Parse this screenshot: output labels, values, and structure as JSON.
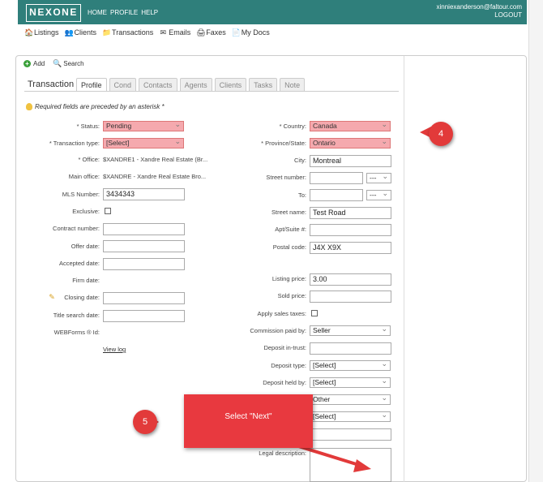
{
  "header": {
    "logo": "NEXONE",
    "nav": [
      "HOME",
      "PROFILE",
      "HELP"
    ],
    "user_email": "xinniexanderson@faltour.com",
    "logout": "LOGOUT"
  },
  "modules": [
    {
      "label": "Listings",
      "icon": "house-icon"
    },
    {
      "label": "Clients",
      "icon": "people-icon"
    },
    {
      "label": "Transactions",
      "icon": "folder-icon"
    },
    {
      "label": "Emails",
      "icon": "envelope-icon"
    },
    {
      "label": "Faxes",
      "icon": "printer-icon"
    },
    {
      "label": "My Docs",
      "icon": "documents-icon"
    }
  ],
  "actions": {
    "add": "Add",
    "search": "Search"
  },
  "page_title": "Transaction",
  "tabs": [
    "Profile",
    "Cond",
    "Contacts",
    "Agents",
    "Clients",
    "Tasks",
    "Note"
  ],
  "required_note": "Required fields are preceded by an asterisk *",
  "left": {
    "status_label": "* Status:",
    "status_value": "Pending",
    "trans_type_label": "* Transaction type:",
    "trans_type_value": "[Select]",
    "office_label": "* Office:",
    "office_value": "$XANDRE1 - Xandre Real Estate (Br...",
    "main_office_label": "Main office:",
    "main_office_value": "$XANDRE - Xandre Real Estate Bro...",
    "mls_label": "MLS Number:",
    "mls_value": "3434343",
    "exclusive_label": "Exclusive:",
    "contract_label": "Contract number:",
    "offer_label": "Offer date:",
    "accepted_label": "Accepted date:",
    "firm_label": "Firm date:",
    "closing_label": "Closing date:",
    "title_search_label": "Title search date:",
    "webforms_label": "WEBForms ® Id:",
    "view_log": "View log"
  },
  "right": {
    "country_label": "* Country:",
    "country_value": "Canada",
    "province_label": "* Province/State:",
    "province_value": "Ontario",
    "city_label": "City:",
    "city_value": "Montreal",
    "street_number_label": "Street number:",
    "street_number_dash": "---",
    "to_label": "To:",
    "to_dash": "---",
    "street_name_label": "Street name:",
    "street_name_value": "Test Road",
    "apt_label": "Apt/Suite #:",
    "postal_label": "Postal code:",
    "postal_value": "J4X X9X",
    "listing_price_label": "Listing price:",
    "listing_price_value": "3.00",
    "sold_price_label": "Sold price:",
    "apply_tax_label": "Apply sales taxes:",
    "commission_label": "Commission paid by:",
    "commission_value": "Seller",
    "deposit_trust_label": "Deposit in-trust:",
    "deposit_type_label": "Deposit type:",
    "deposit_type_value": "[Select]",
    "deposit_held_label": "Deposit held by:",
    "deposit_held_value": "[Select]",
    "other_value": "Other",
    "select_value": "[Select]",
    "legal_label": "Legal description:"
  },
  "annotations": {
    "step4": "4",
    "step5": "5",
    "callout_text": "Select \"Next\"",
    "accent": "#e23a3a"
  }
}
